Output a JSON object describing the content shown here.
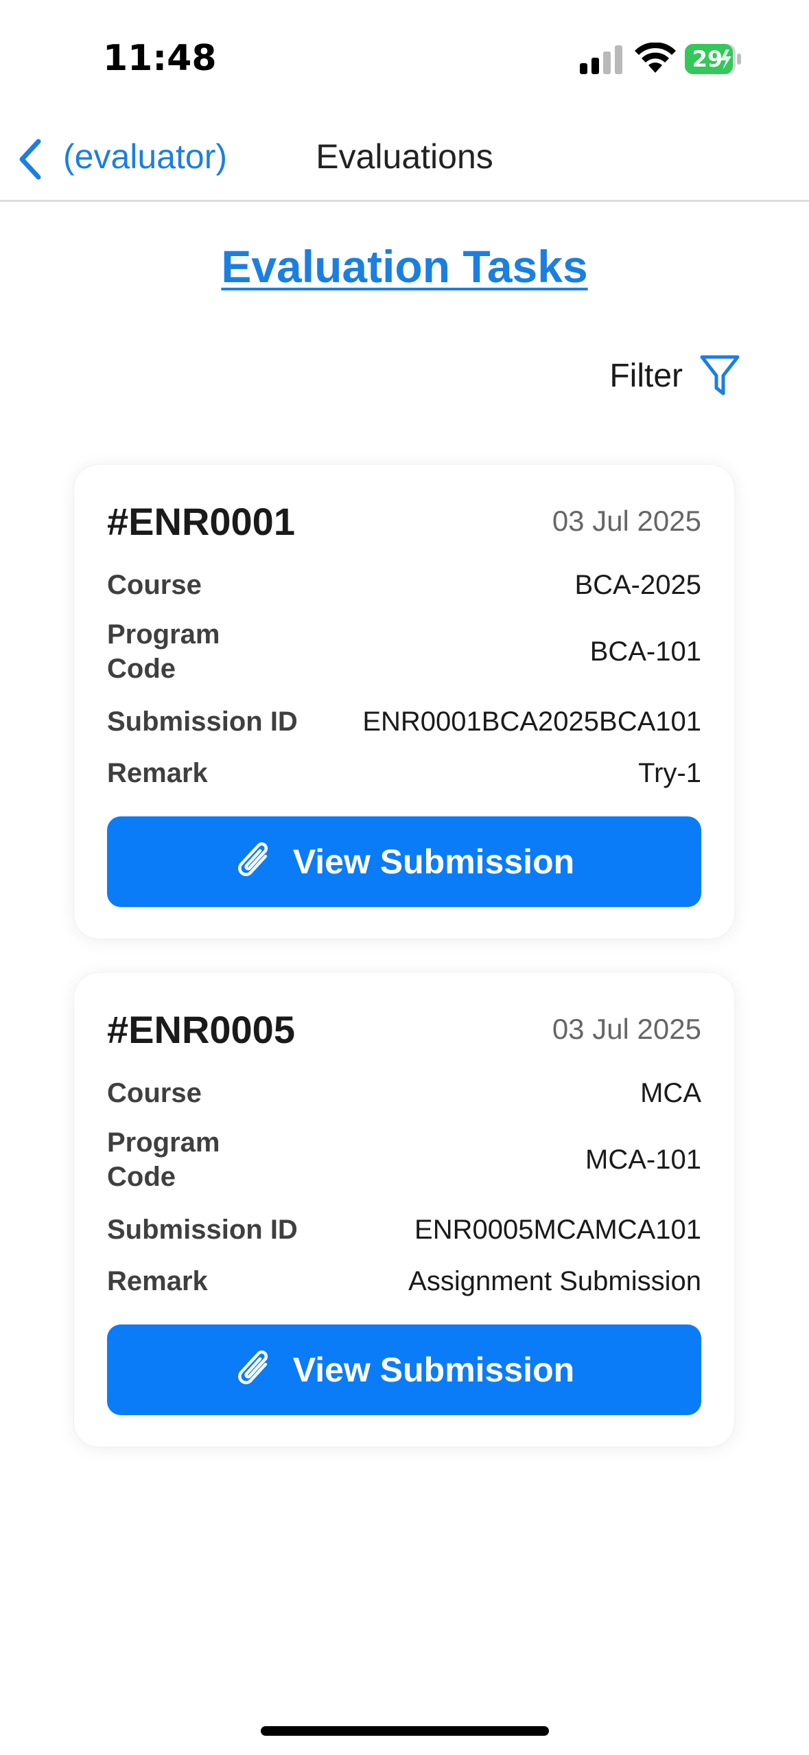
{
  "status_bar": {
    "time": "11:48",
    "battery": "29"
  },
  "nav": {
    "back_label": "(evaluator)",
    "title": "Evaluations"
  },
  "page": {
    "heading": "Evaluation Tasks",
    "filter_label": "Filter"
  },
  "colors": {
    "accent": "#1b7fe0",
    "button": "#0a7cf8",
    "battery": "#34c759"
  },
  "cards": [
    {
      "id": "#ENR0001",
      "date": "03 Jul 2025",
      "rows": [
        {
          "label": "Course",
          "value": "BCA-2025"
        },
        {
          "label": "Program Code",
          "value": "BCA-101"
        },
        {
          "label": "Submission ID",
          "value": "ENR0001BCA2025BCA101"
        },
        {
          "label": "Remark",
          "value": "Try-1"
        }
      ],
      "button_label": "View Submission"
    },
    {
      "id": "#ENR0005",
      "date": "03 Jul 2025",
      "rows": [
        {
          "label": "Course",
          "value": "MCA"
        },
        {
          "label": "Program Code",
          "value": "MCA-101"
        },
        {
          "label": "Submission ID",
          "value": "ENR0005MCAMCA101"
        },
        {
          "label": "Remark",
          "value": "Assignment Submission"
        }
      ],
      "button_label": "View Submission"
    }
  ]
}
